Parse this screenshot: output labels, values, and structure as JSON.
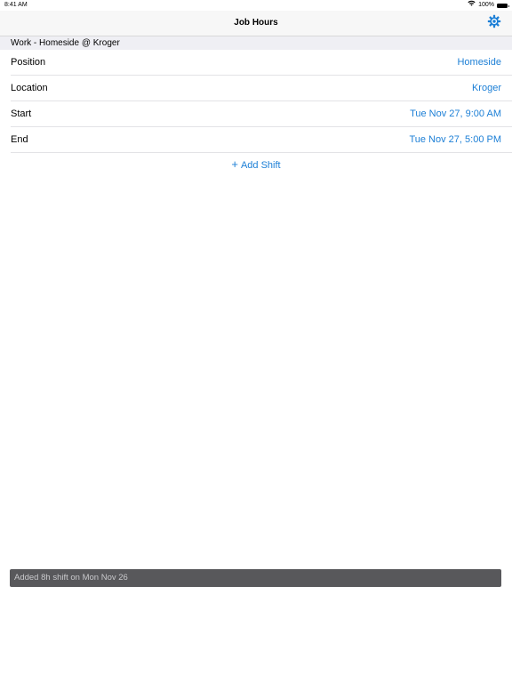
{
  "status_bar": {
    "time": "8:41 AM",
    "battery": "100%",
    "icons": [
      "wifi-icon",
      "battery-icon"
    ]
  },
  "nav": {
    "title": "Job Hours",
    "settings_icon": "gear-icon"
  },
  "section": {
    "header": "Work - Homeside @ Kroger"
  },
  "rows": [
    {
      "label": "Position",
      "value": "Homeside"
    },
    {
      "label": "Location",
      "value": "Kroger"
    },
    {
      "label": "Start",
      "value": "Tue Nov 27, 9:00 AM"
    },
    {
      "label": "End",
      "value": "Tue Nov 27, 5:00 PM"
    }
  ],
  "add_shift": {
    "plus": "+",
    "label": "Add Shift"
  },
  "toast": {
    "message": "Added 8h shift on Mon Nov 26"
  },
  "colors": {
    "accent": "#1c7fd6",
    "toast_bg": "#58585b",
    "nav_bg": "#f7f7f7"
  }
}
